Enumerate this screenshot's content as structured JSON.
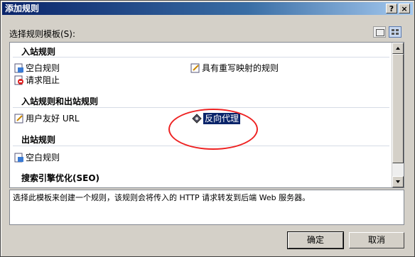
{
  "dialog": {
    "title": "添加规则",
    "help_label": "?",
    "close_label": "×",
    "select_label": "选择规则模板(S):",
    "description": "选择此模板来创建一个规则，该规则会将传入的 HTTP 请求转发到后端 Web 服务器。",
    "ok_label": "确定",
    "cancel_label": "取消"
  },
  "groups": {
    "inbound": {
      "title": "入站规则",
      "items": [
        "空白规则",
        "请求阻止",
        "具有重写映射的规则"
      ]
    },
    "inout": {
      "title": "入站规则和出站规则",
      "items": [
        "用户友好 URL",
        "反向代理"
      ]
    },
    "outbound": {
      "title": "出站规则",
      "items": [
        "空白规则"
      ]
    },
    "seo": {
      "title": "搜索引擎优化(SEO)"
    }
  },
  "selected_item": "反向代理",
  "colors": {
    "selection": "#0a246a",
    "annotation": "#e22222"
  }
}
